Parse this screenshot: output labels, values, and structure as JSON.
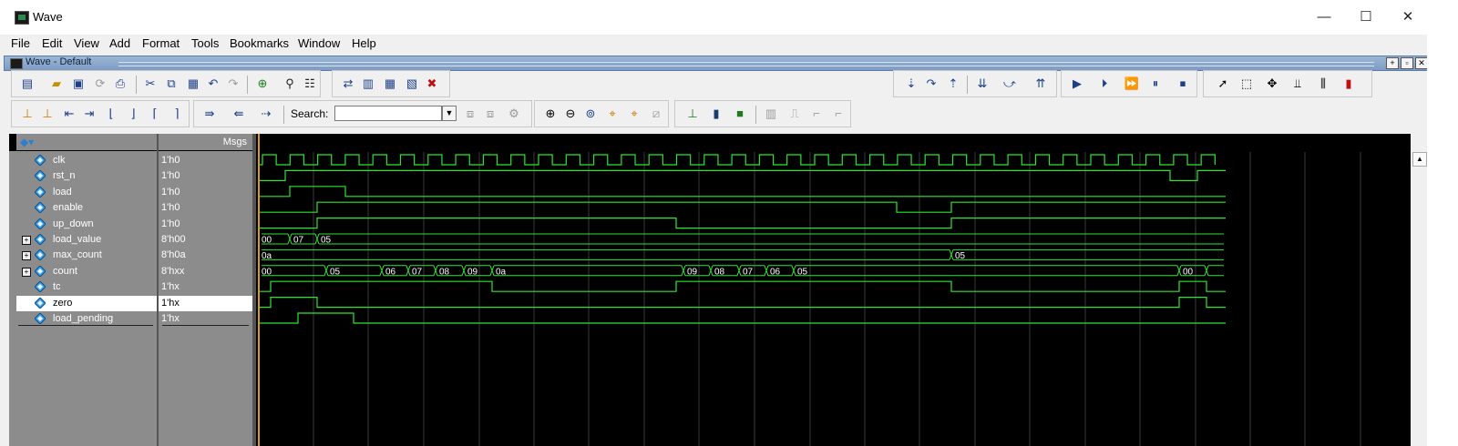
{
  "window": {
    "title": "Wave",
    "controls": [
      "—",
      "☐",
      "✕"
    ]
  },
  "menu": [
    "File",
    "Edit",
    "View",
    "Add",
    "Format",
    "Tools",
    "Bookmarks",
    "Window",
    "Help"
  ],
  "subwindow": {
    "title": "Wave - Default"
  },
  "search": {
    "label": "Search:",
    "value": ""
  },
  "columns": {
    "msgs": "Msgs"
  },
  "signals": [
    {
      "name": "clk",
      "value": "1'h0",
      "expandable": false
    },
    {
      "name": "rst_n",
      "value": "1'h0",
      "expandable": false
    },
    {
      "name": "load",
      "value": "1'h0",
      "expandable": false
    },
    {
      "name": "enable",
      "value": "1'h0",
      "expandable": false
    },
    {
      "name": "up_down",
      "value": "1'h0",
      "expandable": false
    },
    {
      "name": "load_value",
      "value": "8'h00",
      "expandable": true
    },
    {
      "name": "max_count",
      "value": "8'h0a",
      "expandable": true
    },
    {
      "name": "count",
      "value": "8'hxx",
      "expandable": true
    },
    {
      "name": "tc",
      "value": "1'hx",
      "expandable": false
    },
    {
      "name": "zero",
      "value": "1'hx",
      "expandable": false,
      "selected": true
    },
    {
      "name": "load_pending",
      "value": "1'hx",
      "expandable": false
    }
  ],
  "bus_labels": {
    "load_value": [
      "00",
      "07",
      "05"
    ],
    "max_count": [
      "0a",
      "05"
    ],
    "count": [
      "00",
      "05",
      "06",
      "07",
      "08",
      "09",
      "0a",
      "09",
      "08",
      "07",
      "06",
      "05",
      "00"
    ]
  },
  "colors": {
    "wave": "#2ee52e",
    "background": "#000000",
    "cursor": "#d8a000",
    "grid": "#3a3a3a"
  }
}
